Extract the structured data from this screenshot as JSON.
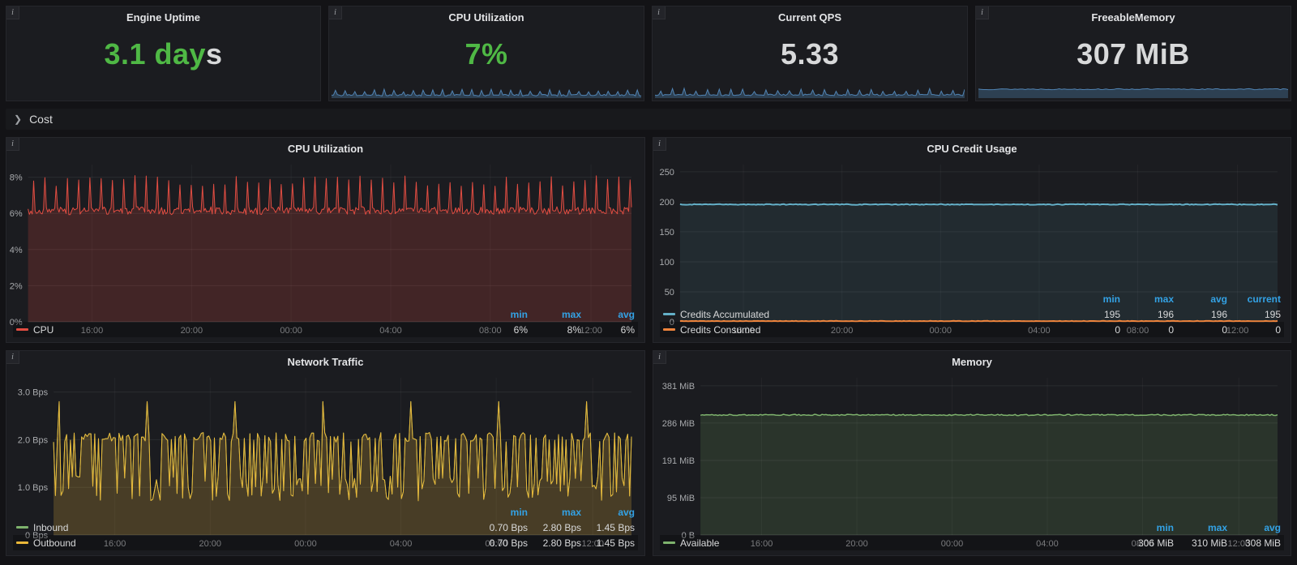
{
  "icons": {
    "info": "i",
    "row_chevron": "❯"
  },
  "spark_style": {
    "line": "#5083b3",
    "fill": "rgba(80,131,179,0.35)"
  },
  "stat_panels": [
    {
      "title": "Engine Uptime",
      "value": "3.1 day",
      "suffix": "s",
      "value_color": "#4fb845",
      "spark": null
    },
    {
      "title": "CPU Utilization",
      "value": "7%",
      "suffix": "",
      "value_color": "#4fb845",
      "spark": {
        "type": "spiky",
        "n": 160,
        "base": 0.18,
        "noise": 0.05,
        "spike_every": 5,
        "spike_lo": 0.38,
        "spike_hi": 0.55,
        "seed": 11
      }
    },
    {
      "title": "Current QPS",
      "value": "5.33",
      "suffix": "",
      "value_color": "#d8d9da",
      "spark": {
        "type": "spiky",
        "n": 160,
        "base": 0.2,
        "noise": 0.05,
        "spike_every": 6,
        "spike_lo": 0.4,
        "spike_hi": 0.6,
        "seed": 12
      }
    },
    {
      "title": "FreeableMemory",
      "value": "307 MiB",
      "suffix": "",
      "value_color": "#d8d9da",
      "spark": {
        "type": "flat",
        "n": 120,
        "base": 0.55,
        "noise": 0.03,
        "seed": 13
      }
    }
  ],
  "row": {
    "label": "Cost"
  },
  "charts": [
    {
      "title": "CPU Utilization",
      "chart_data": {
        "type": "line",
        "ylim": [
          0,
          8.7
        ],
        "ylabel_ticks": [
          {
            "v": 0,
            "label": "0%"
          },
          {
            "v": 2,
            "label": "2%"
          },
          {
            "v": 4,
            "label": "4%"
          },
          {
            "v": 6,
            "label": "6%"
          },
          {
            "v": 8,
            "label": "8%"
          }
        ],
        "x_ticks": [
          {
            "p": 0.106,
            "label": "16:00"
          },
          {
            "p": 0.271,
            "label": "20:00"
          },
          {
            "p": 0.436,
            "label": "00:00"
          },
          {
            "p": 0.601,
            "label": "04:00"
          },
          {
            "p": 0.766,
            "label": "08:00"
          },
          {
            "p": 0.933,
            "label": "12:00"
          }
        ],
        "series": [
          {
            "name": "CPU",
            "color": "#e24d42",
            "fill": "rgba(226,77,66,0.20)",
            "width": 1,
            "gen": {
              "type": "spiky",
              "n": 430,
              "base": 6.15,
              "noise": 0.22,
              "spike_every": 8,
              "spike_lo": 7.5,
              "spike_hi": 8.1,
              "seed": 3
            }
          }
        ],
        "legend": {
          "cols": [
            "min",
            "max",
            "avg"
          ],
          "rows": [
            {
              "name": "CPU",
              "color": "#e24d42",
              "values": [
                "6%",
                "8%",
                "6%"
              ]
            }
          ]
        }
      }
    },
    {
      "title": "CPU Credit Usage",
      "chart_data": {
        "type": "line",
        "ylim": [
          0,
          262
        ],
        "ylabel_ticks": [
          {
            "v": 0,
            "label": "0"
          },
          {
            "v": 50,
            "label": "50"
          },
          {
            "v": 100,
            "label": "100"
          },
          {
            "v": 150,
            "label": "150"
          },
          {
            "v": 200,
            "label": "200"
          },
          {
            "v": 250,
            "label": "250"
          }
        ],
        "x_ticks": [
          {
            "p": 0.106,
            "label": "16:00"
          },
          {
            "p": 0.271,
            "label": "20:00"
          },
          {
            "p": 0.436,
            "label": "00:00"
          },
          {
            "p": 0.601,
            "label": "04:00"
          },
          {
            "p": 0.766,
            "label": "08:00"
          },
          {
            "p": 0.933,
            "label": "12:00"
          }
        ],
        "series": [
          {
            "name": "Credits Accumulated",
            "color": "#64b0c8",
            "fill": "rgba(100,176,200,0.10)",
            "width": 2,
            "gen": {
              "type": "flat",
              "n": 300,
              "base": 195.5,
              "noise": 0.6,
              "seed": 4
            }
          },
          {
            "name": "Credits Consumed",
            "color": "#ef843c",
            "fill": "",
            "width": 2,
            "gen": {
              "type": "flat",
              "n": 300,
              "base": 1.2,
              "noise": 0.4,
              "seed": 5
            }
          }
        ],
        "legend": {
          "cols": [
            "min",
            "max",
            "avg",
            "current"
          ],
          "rows": [
            {
              "name": "Credits Accumulated",
              "color": "#64b0c8",
              "values": [
                "195",
                "196",
                "196",
                "195"
              ]
            },
            {
              "name": "Credits Consumed",
              "color": "#ef843c",
              "values": [
                "0",
                "0",
                "0",
                "0"
              ]
            }
          ]
        }
      }
    },
    {
      "title": "Network Traffic",
      "chart_data": {
        "type": "line",
        "ylim": [
          0,
          3.3
        ],
        "ylabel_ticks": [
          {
            "v": 0,
            "label": "0 Bps"
          },
          {
            "v": 1,
            "label": "1.0 Bps"
          },
          {
            "v": 2,
            "label": "2.0 Bps"
          },
          {
            "v": 3,
            "label": "3.0 Bps"
          }
        ],
        "x_ticks": [
          {
            "p": 0.106,
            "label": "16:00"
          },
          {
            "p": 0.271,
            "label": "20:00"
          },
          {
            "p": 0.436,
            "label": "00:00"
          },
          {
            "p": 0.601,
            "label": "04:00"
          },
          {
            "p": 0.766,
            "label": "08:00"
          },
          {
            "p": 0.933,
            "label": "12:00"
          }
        ],
        "series": [
          {
            "name": "Inbound",
            "color": "#7eb26d",
            "fill": "",
            "width": 1,
            "gen": {
              "type": "comb",
              "n": 310,
              "p_high": 0.6,
              "high_lo": 1.95,
              "high_hi": 2.15,
              "low_lo": 0.72,
              "low_hi": 1.25,
              "spike_every": 47,
              "spike": 2.8,
              "seed": 6
            }
          },
          {
            "name": "Outbound",
            "color": "#eab839",
            "fill": "rgba(234,184,57,0.22)",
            "width": 1,
            "gen": {
              "type": "comb",
              "n": 310,
              "p_high": 0.6,
              "high_lo": 1.95,
              "high_hi": 2.15,
              "low_lo": 0.72,
              "low_hi": 1.25,
              "spike_every": 47,
              "spike": 2.8,
              "seed": 6
            }
          }
        ],
        "legend": {
          "cols": [
            "min",
            "max",
            "avg"
          ],
          "rows": [
            {
              "name": "Inbound",
              "color": "#7eb26d",
              "values": [
                "0.70 Bps",
                "2.80 Bps",
                "1.45 Bps"
              ]
            },
            {
              "name": "Outbound",
              "color": "#eab839",
              "values": [
                "0.70 Bps",
                "2.80 Bps",
                "1.45 Bps"
              ]
            }
          ]
        }
      }
    },
    {
      "title": "Memory",
      "chart_data": {
        "type": "line",
        "ylim": [
          0,
          402
        ],
        "ylabel_ticks": [
          {
            "v": 0,
            "label": "0 B"
          },
          {
            "v": 95.4,
            "label": "95 MiB"
          },
          {
            "v": 190.7,
            "label": "191 MiB"
          },
          {
            "v": 286.1,
            "label": "286 MiB"
          },
          {
            "v": 381.5,
            "label": "381 MiB"
          }
        ],
        "x_ticks": [
          {
            "p": 0.106,
            "label": "16:00"
          },
          {
            "p": 0.271,
            "label": "20:00"
          },
          {
            "p": 0.436,
            "label": "00:00"
          },
          {
            "p": 0.601,
            "label": "04:00"
          },
          {
            "p": 0.766,
            "label": "08:00"
          },
          {
            "p": 0.933,
            "label": "12:00"
          }
        ],
        "series": [
          {
            "name": "Available",
            "color": "#7eb26d",
            "fill": "rgba(126,178,105,0.16)",
            "width": 1.5,
            "gen": {
              "type": "flat",
              "n": 300,
              "base": 307,
              "noise": 1.5,
              "seed": 8
            }
          }
        ],
        "legend": {
          "cols": [
            "min",
            "max",
            "avg"
          ],
          "rows": [
            {
              "name": "Available",
              "color": "#7eb26d",
              "values": [
                "306 MiB",
                "310 MiB",
                "308 MiB"
              ]
            }
          ]
        }
      }
    }
  ]
}
